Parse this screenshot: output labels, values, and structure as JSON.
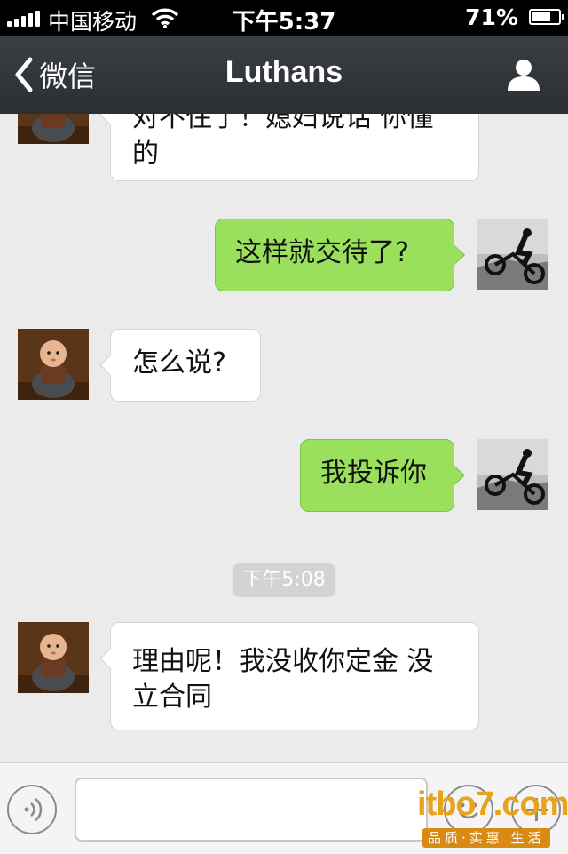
{
  "status_bar": {
    "carrier": "中国移动",
    "time": "下午5:37",
    "battery_percent": "71%",
    "battery_level": 0.71
  },
  "nav": {
    "back_label": "微信",
    "title": "Luthans",
    "icons": {
      "back": "chevron-left-icon",
      "profile": "person-icon"
    }
  },
  "messages": [
    {
      "side": "in",
      "text_line1": "对不住了！媳妇说话 你懂",
      "text_line2": "的"
    },
    {
      "side": "out",
      "text": "这样就交待了?"
    },
    {
      "side": "in",
      "text": "怎么说?"
    },
    {
      "side": "out",
      "text": "我投诉你"
    },
    {
      "side": "in",
      "text_line1": "理由呢！我没收你定金 没",
      "text_line2": "立合同"
    }
  ],
  "timestamp": "下午5:08",
  "input_bar": {
    "icons": {
      "voice": "voice-icon",
      "emoji": "emoji-icon",
      "plus": "plus-icon"
    }
  },
  "watermark": {
    "main": "itbo7.com",
    "sub": "品质·实惠 生活"
  },
  "colors": {
    "outgoing": "#9ae05c",
    "incoming": "#ffffff",
    "navbar": "#2f3338",
    "background": "#ebebeb"
  }
}
